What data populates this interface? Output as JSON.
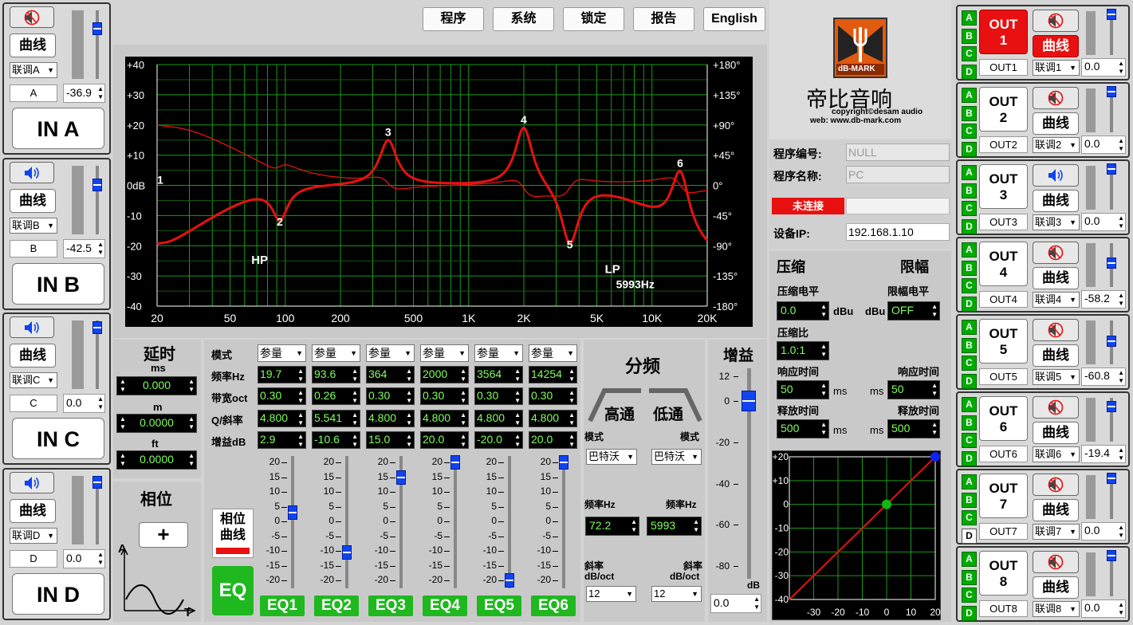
{
  "top_buttons": [
    "程序",
    "系统",
    "锁定",
    "报告",
    "English"
  ],
  "inputs": [
    {
      "id": "A",
      "muted": true,
      "curve": "曲线",
      "link": "联调A",
      "ch": "A",
      "gain": "-36.9",
      "name": "IN A",
      "level": 0.76
    },
    {
      "id": "B",
      "muted": false,
      "curve": "曲线",
      "link": "联调B",
      "ch": "B",
      "gain": "-42.5",
      "name": "IN B",
      "level": 0.74
    },
    {
      "id": "C",
      "muted": false,
      "curve": "曲线",
      "link": "联调C",
      "ch": "C",
      "gain": "0.0",
      "name": "IN C",
      "level": 0.92
    },
    {
      "id": "D",
      "muted": false,
      "curve": "曲线",
      "link": "联调D",
      "ch": "D",
      "gain": "0.0",
      "name": "IN D",
      "level": 0.92
    }
  ],
  "graph": {
    "y_left": [
      "+40",
      "+30",
      "+20",
      "+10",
      "0dB",
      "-10",
      "-20",
      "-30",
      "-40"
    ],
    "y_right": [
      "+180°",
      "+135°",
      "+90°",
      "+45°",
      "0°",
      "-45°",
      "-90°",
      "-135°",
      "-180°"
    ],
    "x": [
      "20",
      "50",
      "100",
      "200",
      "500",
      "1K",
      "2K",
      "5K",
      "10K",
      "20K"
    ],
    "markers": [
      "1",
      "2",
      "3",
      "4",
      "5",
      "6"
    ],
    "hp": "HP",
    "lp": "LP",
    "lp_freq": "5993Hz"
  },
  "delay": {
    "title": "延时",
    "ms_label": "ms",
    "ms": "0.000",
    "m_label": "m",
    "m": "0.0000",
    "ft_label": "ft",
    "ft": "0.0000"
  },
  "phase": {
    "title": "相位",
    "button": "+",
    "axis_a": "A",
    "axis_t": "T"
  },
  "phase_curve": "相位曲线",
  "eq_button": "EQ",
  "eq": {
    "row_labels": [
      "模式",
      "频率Hz",
      "带宽oct",
      "Q/斜率",
      "增益dB"
    ],
    "bands": [
      {
        "mode": "参量",
        "freq": "19.7",
        "bw": "0.30",
        "q": "4.800",
        "gain": "2.9",
        "label": "EQ1",
        "level": 2.9
      },
      {
        "mode": "参量",
        "freq": "93.6",
        "bw": "0.26",
        "q": "5.541",
        "gain": "-10.6",
        "label": "EQ2",
        "level": -10.6
      },
      {
        "mode": "参量",
        "freq": "364",
        "bw": "0.30",
        "q": "4.800",
        "gain": "15.0",
        "label": "EQ3",
        "level": 15
      },
      {
        "mode": "参量",
        "freq": "2000",
        "bw": "0.30",
        "q": "4.800",
        "gain": "20.0",
        "label": "EQ4",
        "level": 20
      },
      {
        "mode": "参量",
        "freq": "3564",
        "bw": "0.30",
        "q": "4.800",
        "gain": "-20.0",
        "label": "EQ5",
        "level": -20
      },
      {
        "mode": "参量",
        "freq": "14254",
        "bw": "0.30",
        "q": "4.800",
        "gain": "20.0",
        "label": "EQ6",
        "level": 20
      }
    ],
    "scale": [
      "20",
      "15",
      "10",
      "5",
      "0",
      "-5",
      "-10",
      "-15",
      "-20"
    ]
  },
  "crossover": {
    "title": "分频",
    "hp": "高通",
    "lp": "低通",
    "mode_label": "模式",
    "hp_mode": "巴特沃",
    "lp_mode": "巴特沃",
    "freq_label": "频率Hz",
    "hp_freq": "72.2",
    "lp_freq": "5993",
    "slope_label": "斜率",
    "slope_unit": "dB/oct",
    "hp_slope": "12",
    "lp_slope": "12"
  },
  "gain": {
    "title": "增益",
    "scale": [
      "12",
      "0",
      "-20",
      "-40",
      "-60",
      "-80"
    ],
    "unit": "dB",
    "value": "0.0",
    "level": 0
  },
  "logo": {
    "brand": "dB-MARK",
    "name": "帝比音响",
    "copyright": "copyright©desam audio",
    "web": "web: www.db-mark.com"
  },
  "program": {
    "num_label": "程序编号:",
    "num": "NULL",
    "name_label": "程序名称:",
    "name": "PC",
    "status": "未连接",
    "ip_label": "设备IP:",
    "ip": "192.168.1.10"
  },
  "compressor": {
    "title": "压缩",
    "limit_title": "限幅",
    "level_label": "压缩电平",
    "level": "0.0",
    "dbu": "dBu",
    "limit_level_label": "限幅电平",
    "limit_level": "OFF",
    "ratio_label": "压缩比",
    "ratio": "1.0:1",
    "attack_label": "响应时间",
    "attack": "50",
    "limit_attack": "50",
    "ms": "ms",
    "release_label": "释放时间",
    "release": "500",
    "limit_release": "500"
  },
  "comp_graph": {
    "y": [
      "+20",
      "+10",
      "0",
      "-10",
      "-20",
      "-30",
      "-40"
    ],
    "x": [
      "-30",
      "-20",
      "-10",
      "0",
      "10",
      "20"
    ]
  },
  "outputs": [
    {
      "label": "OUT 1",
      "active": true,
      "muted": true,
      "curve": "曲线",
      "curve_active": true,
      "name": "OUT1",
      "link": "联调1",
      "gain": "0.0",
      "d_on": true,
      "level": 0.92
    },
    {
      "label": "OUT 2",
      "active": false,
      "muted": true,
      "curve": "曲线",
      "curve_active": false,
      "name": "OUT2",
      "link": "联调2",
      "gain": "0.0",
      "d_on": true,
      "level": 0.92
    },
    {
      "label": "OUT 3",
      "active": false,
      "muted": false,
      "curve": "曲线",
      "curve_active": false,
      "name": "OUT3",
      "link": "联调3",
      "gain": "0.0",
      "d_on": true,
      "level": 0.92
    },
    {
      "label": "OUT 4",
      "active": false,
      "muted": true,
      "curve": "曲线",
      "curve_active": false,
      "name": "OUT4",
      "link": "联调4",
      "gain": "-58.2",
      "d_on": true,
      "level": 0.55
    },
    {
      "label": "OUT 5",
      "active": false,
      "muted": true,
      "curve": "曲线",
      "curve_active": false,
      "name": "OUT5",
      "link": "联调5",
      "gain": "-60.8",
      "d_on": true,
      "level": 0.53
    },
    {
      "label": "OUT 6",
      "active": false,
      "muted": true,
      "curve": "曲线",
      "curve_active": false,
      "name": "OUT6",
      "link": "联调6",
      "gain": "-19.4",
      "d_on": true,
      "level": 0.8
    },
    {
      "label": "OUT 7",
      "active": false,
      "muted": true,
      "curve": "曲线",
      "curve_active": false,
      "name": "OUT7",
      "link": "联调7",
      "gain": "0.0",
      "d_on": false,
      "level": 0.92
    },
    {
      "label": "OUT 8",
      "active": false,
      "muted": true,
      "curve": "曲线",
      "curve_active": false,
      "name": "OUT8",
      "link": "联调8",
      "gain": "0.0",
      "d_on": true,
      "level": 0.92
    }
  ],
  "colors": {
    "accent_red": "#e81010",
    "eq_green": "#1fb81f",
    "led_green": "#0a0",
    "knob_blue": "#1144ee"
  }
}
